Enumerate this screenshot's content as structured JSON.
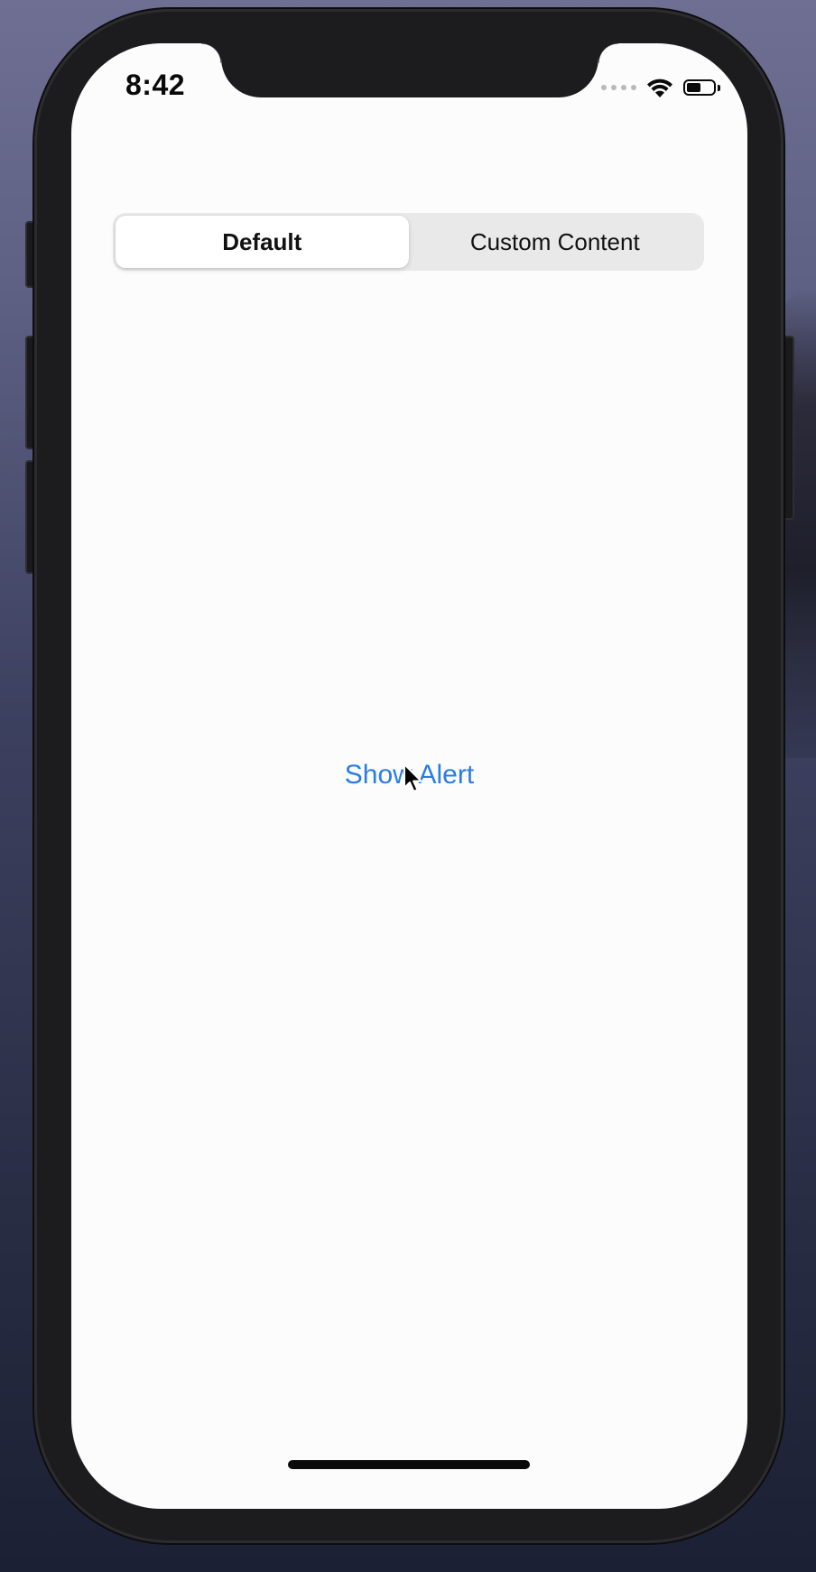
{
  "status_bar": {
    "time": "8:42",
    "signal_icon": "cellular-dots-icon",
    "wifi_icon": "wifi-icon",
    "battery_icon": "battery-icon",
    "battery_level": 0.55
  },
  "segmented_control": {
    "segments": [
      {
        "label": "Default",
        "selected": true
      },
      {
        "label": "Custom Content",
        "selected": false
      }
    ]
  },
  "main": {
    "show_alert_label": "Show Alert",
    "accent_color": "#2b7de0"
  },
  "pointer_icon": "mouse-cursor-icon"
}
